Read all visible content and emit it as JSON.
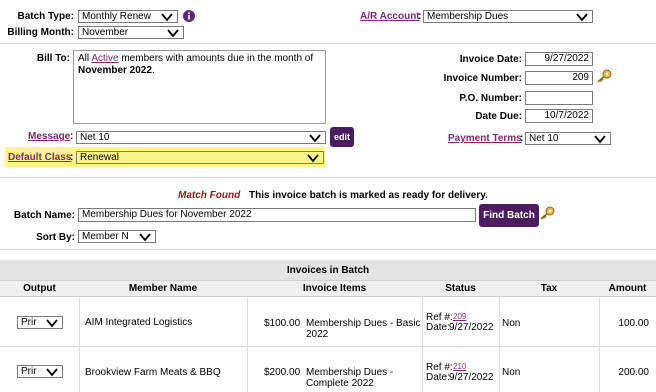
{
  "header": {
    "batch_type_label": "Batch Type:",
    "batch_type_value": "Monthly Renew",
    "billing_month_label": "Billing Month:",
    "billing_month_value": "November",
    "ar_account_label": "A/R Account",
    "ar_account_value": "Membership Dues"
  },
  "billing": {
    "bill_to_label": "Bill To:",
    "bill_to_pre": "All ",
    "bill_to_link": "Active",
    "bill_to_mid": " members with amounts due in the month of ",
    "bill_to_month": "November 2022",
    "bill_to_end": ".",
    "message_label": "Message",
    "message_value": "Net 10",
    "edit_label": "edit",
    "default_class_label": "Default Class",
    "default_class_value": "Renewal"
  },
  "invoice": {
    "date_label": "Invoice Date:",
    "date_value": "9/27/2022",
    "number_label": "Invoice Number:",
    "number_value": "209",
    "po_label": "P.O. Number:",
    "po_value": "",
    "due_label": "Date Due:",
    "due_value": "10/7/2022",
    "terms_label": "Payment Terms",
    "terms_value": "Net 10"
  },
  "match": {
    "found_label": "Match Found",
    "message": "This invoice batch is marked as ready for delivery.",
    "batch_name_label": "Batch Name:",
    "batch_name_value": "Membership Dues for November 2022",
    "find_batch_label": "Find Batch",
    "sort_by_label": "Sort By:",
    "sort_by_value": "Member N"
  },
  "table": {
    "title": "Invoices in Batch",
    "columns": [
      "Output",
      "Member Name",
      "Invoice Items",
      "Status",
      "Tax",
      "Amount"
    ],
    "rows": [
      {
        "output": "Prir",
        "member": "AIM Integrated Logistics",
        "item_price": "$100.00",
        "item_line1": "Membership Dues - Basic",
        "item_line2": "2022",
        "ref_label": "Ref #:",
        "ref": "209",
        "date_label": "Date:",
        "date": "9/27/2022",
        "tax": "Non",
        "amount": "100.00"
      },
      {
        "output": "Prir",
        "member": "Brookview Farm Meats & BBQ",
        "item_price": "$200.00",
        "item_line1": "Membership Dues -",
        "item_line2": "Complete 2022",
        "ref_label": "Ref #:",
        "ref": "210",
        "date_label": "Date:",
        "date": "9/27/2022",
        "tax": "Non",
        "amount": "200.00"
      }
    ]
  },
  "colors": {
    "accent": "#4a1e5e",
    "link": "#7a2a6e",
    "highlight": "#fbf58c",
    "match_found": "#8b1a1a"
  }
}
